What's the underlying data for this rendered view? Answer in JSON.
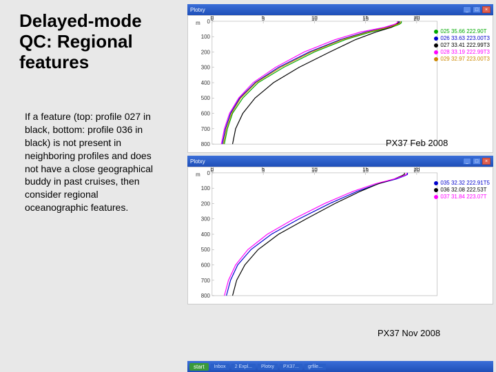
{
  "title": "Delayed-mode QC: Regional features",
  "body": "If a feature (top: profile 027 in black, bottom: profile 036 in black) is not present in neighboring profiles and does not have a close geographical buddy in past cruises, then consider regional oceanographic features.",
  "captions": {
    "top": "PX37  Feb 2008",
    "bottom": "PX37  Nov 2008"
  },
  "window": {
    "title": "Plotxy",
    "buttons": {
      "min": "_",
      "max": "□",
      "close": "×"
    }
  },
  "taskbar": {
    "start": "start",
    "items": [
      "Inbox",
      "2 Expl...",
      "Plotxy",
      "PX37...",
      "grfile..."
    ],
    "tray": " "
  },
  "chart_data": [
    {
      "type": "line",
      "title": "",
      "xlabel": "",
      "ylabel": "m",
      "x_ticks": [
        0,
        5,
        10,
        15,
        20
      ],
      "y_ticks": [
        0,
        100,
        200,
        300,
        400,
        500,
        600,
        700,
        800
      ],
      "xlim": [
        0,
        22
      ],
      "ylim": [
        800,
        0
      ],
      "legend_position": "right",
      "series": [
        {
          "name": "025",
          "lat": "35.66",
          "lon": "222.90T",
          "color": "#00aa00",
          "x": [
            1.2,
            1.5,
            2.0,
            3.0,
            4.5,
            7.0,
            10.0,
            13.0,
            15.5,
            17.5,
            18.3,
            18.5,
            18.5
          ],
          "y": [
            800,
            700,
            600,
            500,
            400,
            300,
            200,
            120,
            70,
            40,
            20,
            10,
            0
          ]
        },
        {
          "name": "026",
          "lat": "33.63",
          "lon": "223.00T3",
          "color": "#0000cc",
          "x": [
            1.0,
            1.3,
            1.8,
            2.7,
            4.2,
            6.5,
            9.5,
            12.5,
            15.0,
            17.0,
            18.0,
            18.3,
            18.3
          ],
          "y": [
            800,
            700,
            600,
            500,
            400,
            300,
            200,
            120,
            70,
            40,
            20,
            10,
            0
          ]
        },
        {
          "name": "027",
          "lat": "33.41",
          "lon": "222.99T3",
          "color": "#000000",
          "x": [
            2.0,
            2.3,
            3.0,
            4.2,
            6.0,
            8.5,
            11.5,
            14.0,
            16.0,
            17.5,
            18.0,
            18.2,
            18.2
          ],
          "y": [
            800,
            700,
            600,
            500,
            400,
            300,
            200,
            120,
            70,
            40,
            20,
            10,
            0
          ]
        },
        {
          "name": "028",
          "lat": "33.19",
          "lon": "222.99T3",
          "color": "#ff00ff",
          "x": [
            0.9,
            1.2,
            1.7,
            2.6,
            4.0,
            6.2,
            9.0,
            12.0,
            14.5,
            16.8,
            17.8,
            18.1,
            18.1
          ],
          "y": [
            800,
            700,
            600,
            500,
            400,
            300,
            200,
            120,
            70,
            40,
            20,
            10,
            0
          ]
        },
        {
          "name": "029",
          "lat": "32.97",
          "lon": "223.00T3",
          "color": "#cc8800",
          "x": [
            1.1,
            1.4,
            1.9,
            2.8,
            4.3,
            6.7,
            9.7,
            12.7,
            15.2,
            17.2,
            18.1,
            18.4,
            18.4
          ],
          "y": [
            800,
            700,
            600,
            500,
            400,
            300,
            200,
            120,
            70,
            40,
            20,
            10,
            0
          ]
        }
      ]
    },
    {
      "type": "line",
      "title": "",
      "xlabel": "",
      "ylabel": "m",
      "x_ticks": [
        0,
        5,
        10,
        15,
        20
      ],
      "y_ticks": [
        0,
        100,
        200,
        300,
        400,
        500,
        600,
        700,
        800
      ],
      "xlim": [
        0,
        22
      ],
      "ylim": [
        800,
        0
      ],
      "legend_position": "right",
      "series": [
        {
          "name": "035",
          "lat": "32.32",
          "lon": "222.91T5",
          "color": "#0000cc",
          "x": [
            1.4,
            1.8,
            2.5,
            3.8,
            5.8,
            8.5,
            11.5,
            14.2,
            16.3,
            18.0,
            18.8,
            19.1,
            19.1
          ],
          "y": [
            800,
            700,
            600,
            500,
            400,
            300,
            200,
            120,
            70,
            40,
            20,
            10,
            0
          ]
        },
        {
          "name": "036",
          "lat": "32.08",
          "lon": "222.53T",
          "color": "#000000",
          "x": [
            2.0,
            2.4,
            3.2,
            4.5,
            6.5,
            9.2,
            12.0,
            14.5,
            16.3,
            17.8,
            18.5,
            18.8,
            18.8
          ],
          "y": [
            800,
            700,
            600,
            500,
            400,
            300,
            200,
            120,
            70,
            40,
            20,
            10,
            0
          ]
        },
        {
          "name": "037",
          "lat": "31.84",
          "lon": "223.07T",
          "color": "#ff00ff",
          "x": [
            1.2,
            1.6,
            2.3,
            3.5,
            5.4,
            8.0,
            11.0,
            13.8,
            16.0,
            17.8,
            18.7,
            19.0,
            19.0
          ],
          "y": [
            800,
            700,
            600,
            500,
            400,
            300,
            200,
            120,
            70,
            40,
            20,
            10,
            0
          ]
        }
      ]
    }
  ]
}
